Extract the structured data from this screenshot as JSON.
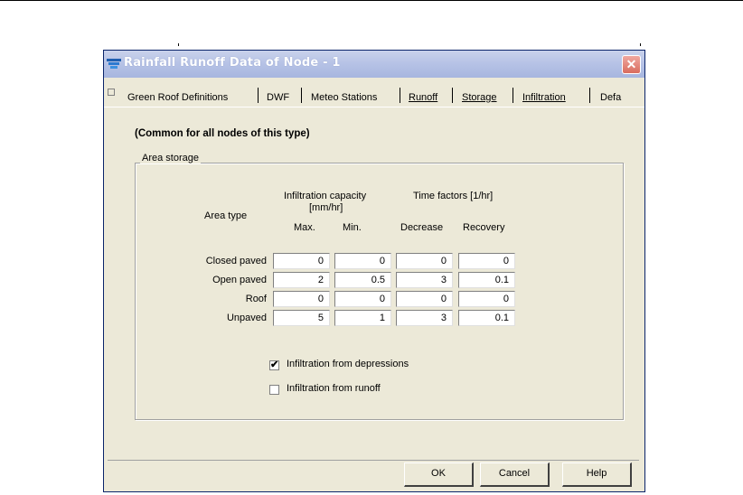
{
  "window": {
    "title": "Rainfall Runoff Data of Node - 1",
    "close_icon": "close-icon"
  },
  "tabs": [
    {
      "label": "Green Roof Definitions"
    },
    {
      "label": "DWF"
    },
    {
      "label": "Meteo Stations"
    },
    {
      "label": "Runoff"
    },
    {
      "label": "Storage"
    },
    {
      "label": "Infiltration"
    },
    {
      "label": "Defa"
    }
  ],
  "panel": {
    "heading": "(Common for all nodes of this type)",
    "group_label": "Area storage",
    "col_area_type": "Area type",
    "infiltration_capacity": "Infiltration capacity",
    "infiltration_unit": "[mm/hr]",
    "time_factors": "Time factors [1/hr]",
    "col_max": "Max.",
    "col_min": "Min.",
    "col_decrease": "Decrease",
    "col_recovery": "Recovery",
    "rows": [
      {
        "label": "Closed paved",
        "values": [
          "0",
          "0",
          "0",
          "0"
        ]
      },
      {
        "label": "Open paved",
        "values": [
          "2",
          "0.5",
          "3",
          "0.1"
        ]
      },
      {
        "label": "Roof",
        "values": [
          "0",
          "0",
          "0",
          "0"
        ]
      },
      {
        "label": "Unpaved",
        "values": [
          "5",
          "1",
          "3",
          "0.1"
        ]
      }
    ],
    "check_depressions": {
      "label": "Infiltration from depressions",
      "checked": true,
      "mark": "✔"
    },
    "check_runoff": {
      "label": "Infiltration from runoff",
      "checked": false,
      "mark": ""
    }
  },
  "buttons": {
    "ok": "OK",
    "cancel": "Cancel",
    "help": "Help"
  },
  "colors": {
    "dialog_bg": "#ece9d8",
    "title_gradient": "#b7c3e6",
    "close_red": "#d96c5e"
  }
}
